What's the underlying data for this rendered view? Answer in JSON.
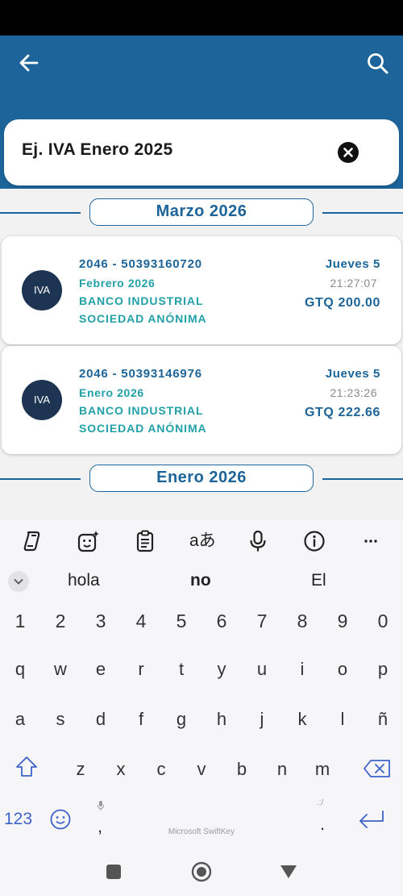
{
  "search": {
    "value": "Ej. IVA Enero 2025"
  },
  "sections": [
    {
      "label": "Marzo 2026"
    },
    {
      "label": "Enero 2026"
    }
  ],
  "transactions": [
    {
      "avatar": "IVA",
      "id": "2046 - 50393160720",
      "period": "Febrero 2026",
      "bank1": "BANCO INDUSTRIAL",
      "bank2": "SOCIEDAD ANÓNIMA",
      "day": "Jueves 5",
      "time": "21:27:07",
      "amount": "GTQ 200.00"
    },
    {
      "avatar": "IVA",
      "id": "2046 - 50393146976",
      "period": "Enero 2026",
      "bank1": "BANCO INDUSTRIAL",
      "bank2": "SOCIEDAD ANÓNIMA",
      "day": "Jueves 5",
      "time": "21:23:26",
      "amount": "GTQ 222.66"
    }
  ],
  "keyboard": {
    "suggestions": [
      "hola",
      "no",
      "El"
    ],
    "numbers": [
      "1",
      "2",
      "3",
      "4",
      "5",
      "6",
      "7",
      "8",
      "9",
      "0"
    ],
    "row1": [
      "q",
      "w",
      "e",
      "r",
      "t",
      "y",
      "u",
      "i",
      "o",
      "p"
    ],
    "row2": [
      "a",
      "s",
      "d",
      "f",
      "g",
      "h",
      "j",
      "k",
      "l",
      "ñ"
    ],
    "row3": [
      "z",
      "x",
      "c",
      "v",
      "b",
      "n",
      "m"
    ],
    "numbers_key": "123",
    "comma": ",",
    "period": ".",
    "brand": "Microsoft SwiftKey"
  },
  "colors": {
    "primary": "#1c6499",
    "accent": "#22a0a8",
    "avatar": "#1d3552"
  }
}
